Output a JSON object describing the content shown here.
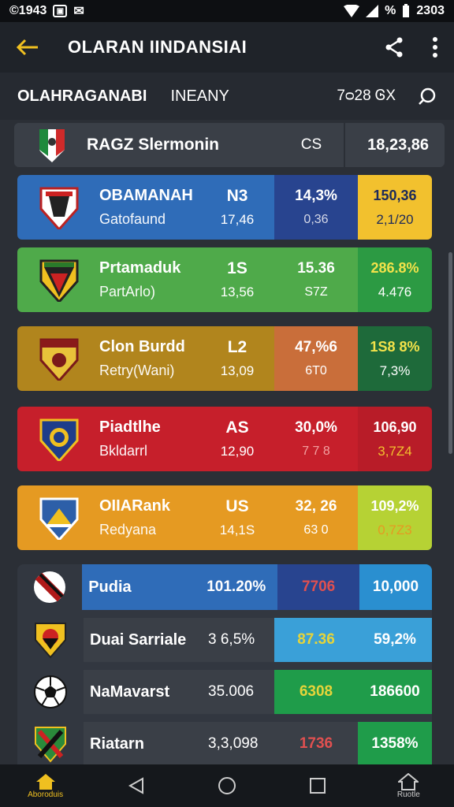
{
  "status_bar": {
    "left_text": "©1943",
    "right_text": "%",
    "time": "2303"
  },
  "app_bar": {
    "title": "OLARAN IINDANSIAI",
    "back_icon": "arrow-left-icon",
    "share_icon": "share-icon",
    "menu_icon": "more-vert-icon"
  },
  "sub_header": {
    "title": "OLAHRAGANABI",
    "subtitle": "INEANY",
    "right_text": "7ᴑ28 ᎶX",
    "search_icon": "search-icon"
  },
  "summary": {
    "name": "RAGZ Slermonin",
    "code": "CS",
    "value": "18,23,86"
  },
  "colors": {
    "blue": "#2f6cb8",
    "blue_dark": "#28448f",
    "yellow": "#f2c12e",
    "green": "#4faa4a",
    "green_dark": "#2c9a43",
    "gold": "#b1851d",
    "orange_mid": "#c96e3a",
    "green_deep": "#1e6a3a",
    "red": "#c61f2b",
    "red_dark": "#b81c28",
    "orange": "#e59a22",
    "lime": "#b6d234"
  },
  "cards": [
    {
      "name": "OBAMANAH",
      "sub": "Gatofaund",
      "code": "N3",
      "code_sub": "17,46",
      "c3": "14,3%",
      "c3_sub": "0,36",
      "c4": "150,36",
      "c4_sub": "2,1/20"
    },
    {
      "name": "Prtamaduk",
      "sub": "PartArlo)",
      "code": "1S",
      "code_sub": "13,56",
      "c3": "15.36",
      "c3_sub": "S7Z",
      "c4": "286.8%",
      "c4_sub": "4.476"
    },
    {
      "name": "Clon Burdd",
      "sub": "Retry(Wani)",
      "code": "L2",
      "code_sub": "13,09",
      "c3": "47,%6",
      "c3_sub": "6T0",
      "c4": "1S8 8%",
      "c4_sub": "7,3%"
    },
    {
      "name": "Piadtlhe",
      "sub": "Bkldarrl",
      "code": "AS",
      "code_sub": "12,90",
      "c3": "30,0%",
      "c3_sub": "7 7 8",
      "c4": "106,90",
      "c4_sub": "3,7Z4"
    },
    {
      "name": "OIIARank",
      "sub": "Redyana",
      "code": "US",
      "code_sub": "14,1S",
      "c3": "32, 26",
      "c3_sub": "63 0",
      "c4": "109,2%",
      "c4_sub": "0,7Z3"
    }
  ],
  "list_rows": [
    {
      "name": "Pudia",
      "v1": "101.20%",
      "v2": "7706",
      "v3": "10,000",
      "icon": "red-black-ball-icon"
    },
    {
      "name": "Duai Sarriale",
      "v1": "3 6,5%",
      "v2": "87.36",
      "v3": "59,2%",
      "icon": "crest-icon"
    },
    {
      "name": "NaMavarst",
      "v1": "35.006",
      "v2": "6308",
      "v3": "186600",
      "icon": "soccer-ball-icon"
    },
    {
      "name": "Riatarn",
      "v1": "3,3,098",
      "v2": "1736",
      "v3": "1358%",
      "icon": "crest-icon"
    }
  ],
  "nav": {
    "home_label": "Aboroduis",
    "profile_label": "Ruotle"
  }
}
